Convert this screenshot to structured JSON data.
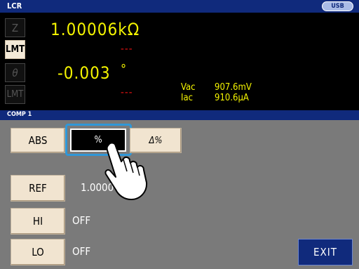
{
  "header": {
    "title": "LCR",
    "usb_label": "USB"
  },
  "measurement": {
    "param1": {
      "label": "Z",
      "value": "1.00006kΩ",
      "limit_tag": "LMT",
      "judge": "---"
    },
    "param2": {
      "label": "θ",
      "value": "-0.003",
      "unit": "°",
      "limit_tag": "LMT",
      "judge": "---"
    },
    "monitor": [
      {
        "label": "Vac",
        "value": "907.6mV"
      },
      {
        "label": "Iac",
        "value": "910.6μA"
      }
    ]
  },
  "comp": {
    "title": "COMP 1",
    "mode_buttons": {
      "abs": "ABS",
      "percent": "%",
      "delta_percent": "Δ%"
    },
    "selected_mode": "%",
    "ref": {
      "label": "REF",
      "value": "1.0000"
    },
    "hi": {
      "label": "HI",
      "value": "OFF"
    },
    "lo": {
      "label": "LO",
      "value": "OFF"
    },
    "exit_label": "EXIT"
  },
  "colors": {
    "reading": "#f4f400",
    "judge": "#e01010",
    "bar": "#102a7c",
    "highlight": "#2f97d8"
  }
}
